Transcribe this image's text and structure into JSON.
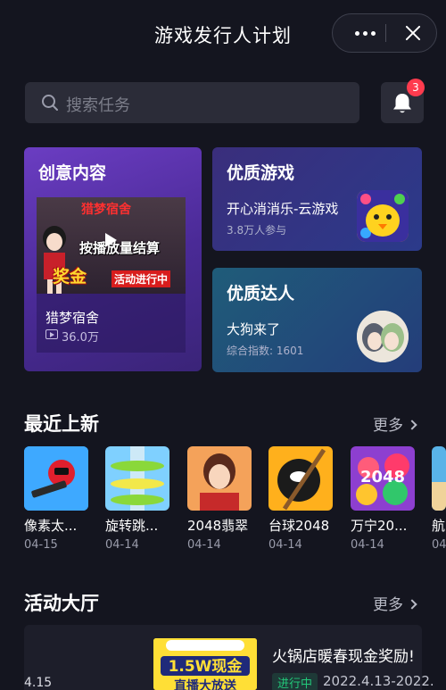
{
  "header": {
    "title": "游戏发行人计划",
    "more_icon": "more-dots-icon",
    "close_icon": "close-icon"
  },
  "search": {
    "placeholder": "搜索任务",
    "icon": "search-icon"
  },
  "notifications": {
    "icon": "bell-icon",
    "badge": "3"
  },
  "cards": {
    "creative": {
      "title": "创意内容",
      "video_overlay_1": "猎梦宿舍",
      "video_overlay_2": "按播放量结算",
      "video_overlay_3": "奖金",
      "video_overlay_4": "活动进行中",
      "video_title": "猎梦宿舍",
      "video_views": "36.0万"
    },
    "game": {
      "title": "优质游戏",
      "name": "开心消消乐-云游戏",
      "meta": "3.8万人参与"
    },
    "talent": {
      "title": "优质达人",
      "name": "大狗来了",
      "meta": "综合指数: 1601"
    }
  },
  "recent": {
    "title": "最近上新",
    "more": "更多",
    "items": [
      {
        "name": "像素太...",
        "date": "04-15",
        "color": "#3ea9ff"
      },
      {
        "name": "旋转跳...",
        "date": "04-14",
        "color": "#6cc8ff"
      },
      {
        "name": "2048翡翠",
        "date": "04-14",
        "color": "#f4a25a"
      },
      {
        "name": "台球2048",
        "date": "04-14",
        "color": "#ff9a1c"
      },
      {
        "name": "万宁20...",
        "date": "04-14",
        "color": "#b04ad8"
      },
      {
        "name": "航",
        "date": "04",
        "color": "#59b3e8"
      }
    ]
  },
  "activity": {
    "title": "活动大厅",
    "more": "更多",
    "date": "4.15",
    "poster_text_1": "1.5W现金",
    "poster_text_2": "直播大放送",
    "item_title": "火锅店暖春现金奖励!",
    "status": "进行中",
    "range": "2022.4.13-2022."
  },
  "colors": {
    "background": "#14151f",
    "accent_green": "#23c87a",
    "badge_red": "#ff3b4e"
  }
}
